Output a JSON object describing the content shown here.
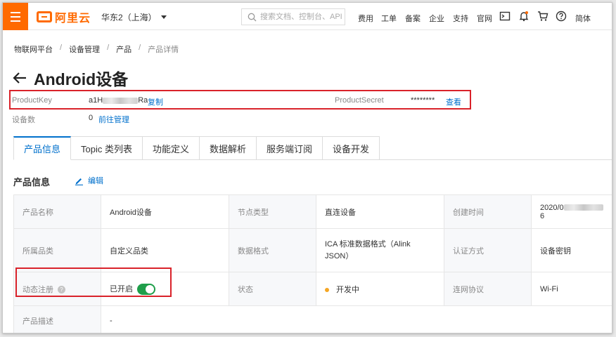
{
  "header": {
    "logo_text": "阿里云",
    "region": "华东2（上海）",
    "search_placeholder": "搜索文档、控制台、API",
    "nav": [
      "费用",
      "工单",
      "备案",
      "企业",
      "支持",
      "官网"
    ],
    "lang": "简体",
    "icons": [
      "terminal-icon",
      "bell-icon",
      "cart-icon",
      "help-icon"
    ]
  },
  "breadcrumb": [
    "物联网平台",
    "设备管理",
    "产品",
    "产品详情"
  ],
  "page_title": "Android设备",
  "product_key": {
    "label": "ProductKey",
    "value_prefix": "a1H",
    "value_suffix": "Ra",
    "copy_label": "复制"
  },
  "product_secret": {
    "label": "ProductSecret",
    "value": "********",
    "view_label": "查看"
  },
  "device_count": {
    "label": "设备数",
    "value": "0",
    "link": "前往管理"
  },
  "tabs": [
    "产品信息",
    "Topic 类列表",
    "功能定义",
    "数据解析",
    "服务端订阅",
    "设备开发"
  ],
  "active_tab": "产品信息",
  "section": {
    "title": "产品信息",
    "edit_label": "编辑"
  },
  "table": {
    "r1": {
      "l1": "产品名称",
      "v1": "Android设备",
      "l2": "节点类型",
      "v2": "直连设备",
      "l3": "创建时间",
      "v3_prefix": "2020/0",
      "v3_suffix": "6"
    },
    "r2": {
      "l1": "所属品类",
      "v1": "自定义品类",
      "l2": "数据格式",
      "v2": "ICA 标准数据格式（Alink JSON）",
      "l3": "认证方式",
      "v3": "设备密钥"
    },
    "r3": {
      "l1": "动态注册",
      "v1": "已开启",
      "l2": "状态",
      "v2": "开发中",
      "l3": "连网协议",
      "v3": "Wi-Fi"
    },
    "r4": {
      "l1": "产品描述",
      "v1": "-"
    }
  },
  "colors": {
    "brand": "#ff6a00",
    "link": "#0070cc",
    "highlight": "#d9222a",
    "toggle_on": "#1f9e4a",
    "status_dot": "#f5a623"
  }
}
